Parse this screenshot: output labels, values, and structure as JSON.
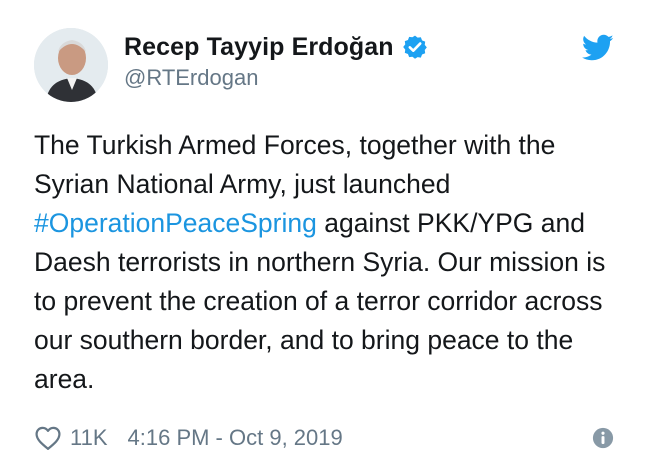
{
  "author": {
    "display_name": "Recep Tayyip Erdoğan",
    "handle": "@RTErdogan",
    "verified": true
  },
  "tweet": {
    "line_before_hashtag": "The Turkish Armed Forces, together with the Syrian National Army, just launched ",
    "hashtag": "#OperationPeaceSpring",
    "line_after_hashtag": " against PKK/YPG and Daesh terrorists in northern Syria. Our mission is to prevent the creation of a terror corridor across our southern border, and to bring peace to the area."
  },
  "footer": {
    "likes": "11K",
    "timestamp": "4:16 PM - Oct 9, 2019"
  },
  "colors": {
    "brand_blue": "#1da1f2",
    "hashtag_blue": "#1b95e0",
    "secondary_text": "#657786"
  },
  "icons": {
    "bird": "twitter-bird-icon",
    "verified": "verified-badge-icon",
    "heart": "heart-outline-icon",
    "info": "info-icon"
  }
}
